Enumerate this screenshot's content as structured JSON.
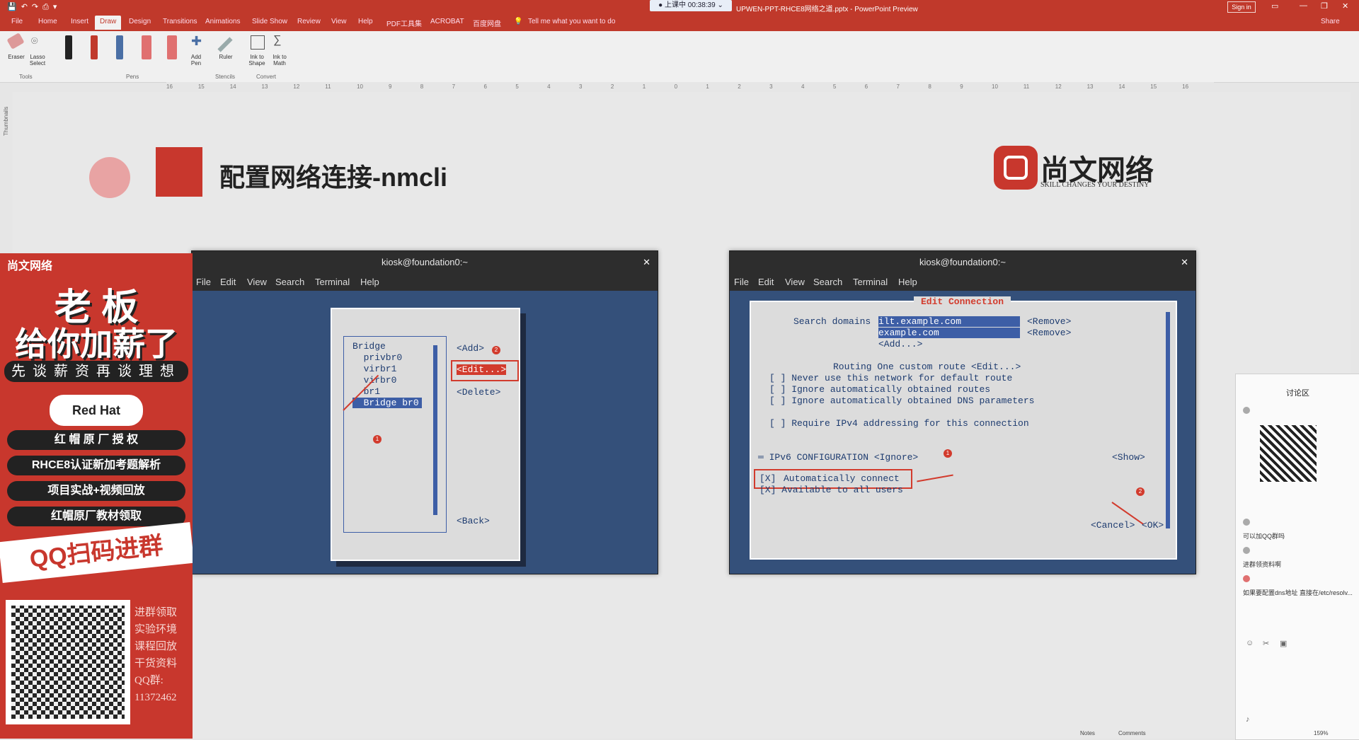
{
  "titlebar": {
    "recording": "● 上课中 00:38:39 ⌄",
    "document": "UPWEN-PPT-RHCE8网络之道.pptx - PowerPoint Preview",
    "sign_in": "Sign in"
  },
  "ribbon_tabs": [
    "File",
    "Home",
    "Insert",
    "Draw",
    "Design",
    "Transitions",
    "Animations",
    "Slide Show",
    "Review",
    "View",
    "Help",
    "PDF工具集",
    "ACROBAT",
    "百度网盘"
  ],
  "active_tab": "Draw",
  "tell_me": "Tell me what you want to do",
  "share": "Share",
  "ribbon": {
    "eraser": "Eraser",
    "lasso": "Lasso Select",
    "tools_group": "Tools",
    "pens_group": "Pens",
    "add_pen": "Add Pen",
    "ruler": "Ruler",
    "stencils_group": "Stencils",
    "ink_to_shape": "Ink to Shape",
    "ink_to_math": "Ink to Math",
    "convert_group": "Convert",
    "pen_colors": [
      "#222222",
      "#c0392b",
      "#4a6fa5",
      "#e07070",
      "#e07070"
    ]
  },
  "ruler_ticks": [
    "16",
    "15",
    "14",
    "13",
    "12",
    "11",
    "10",
    "9",
    "8",
    "7",
    "6",
    "5",
    "4",
    "3",
    "2",
    "1",
    "0",
    "1",
    "2",
    "3",
    "4",
    "5",
    "6",
    "7",
    "8",
    "9",
    "10",
    "11",
    "12",
    "13",
    "14",
    "15",
    "16"
  ],
  "thumbnails_label": "Thumbnails",
  "slide": {
    "title": "配置网络连接-nmcli",
    "logo_name": "尚文网络",
    "logo_tagline": "SKILL CHANGES YOUR DESTINY"
  },
  "term_left": {
    "title": "kiosk@foundation0:~",
    "menu": [
      "File",
      "Edit",
      "View",
      "Search",
      "Terminal",
      "Help"
    ],
    "list": [
      "Bridge",
      "  privbr0",
      "  virbr1",
      "  virbr0",
      "  br1",
      "  Bridge br0"
    ],
    "btn_add": "<Add>",
    "btn_edit": "<Edit...>",
    "btn_delete": "<Delete>",
    "btn_back": "<Back>",
    "marker_1": "1",
    "marker_2": "2"
  },
  "term_right": {
    "title": "kiosk@foundation0:~",
    "menu": [
      "File",
      "Edit",
      "View",
      "Search",
      "Terminal",
      "Help"
    ],
    "dialog_title": "Edit Connection",
    "search_domains_label": "Search domains",
    "domain1": "ilt.example.com",
    "domain2": "example.com",
    "remove": "<Remove>",
    "add": "<Add...>",
    "routing": "Routing One custom route <Edit...>",
    "opt1": "[ ] Never use this network for default route",
    "opt2": "[ ] Ignore automatically obtained routes",
    "opt3": "[ ] Ignore automatically obtained DNS parameters",
    "opt4": "[ ] Require IPv4 addressing for this connection",
    "ipv6": "═ IPv6 CONFIGURATION <Ignore>",
    "show": "<Show>",
    "auto_box": "[X]",
    "auto_connect": "Automatically connect",
    "avail": "[X] Available to all users",
    "cancel": "<Cancel>",
    "ok": "<OK>",
    "marker_1": "1",
    "marker_2": "2"
  },
  "poster": {
    "brand": "尚文网络",
    "headline1": "老 板",
    "headline2": "给你加薪了",
    "subline": "先谈薪资再谈理想",
    "redhat": "Red Hat",
    "pills": [
      "红 帽 原 厂 授 权",
      "RHCE8认证新加考题解析",
      "项目实战+视频回放",
      "红帽原厂教材领取"
    ],
    "qq": "QQ扫码进群",
    "side_text": [
      "进群领取",
      "实验环境",
      "课程回放",
      "干货资料",
      "QQ群:",
      "11372462"
    ]
  },
  "chat": {
    "title": "讨论区",
    "messages": [
      "可以加QQ群吗",
      "进群领资料啊",
      "如果要配置dns地址 直接在/etc/resolv..."
    ]
  },
  "statusbar": {
    "notes": "Notes",
    "comments": "Comments",
    "zoom": "159%"
  }
}
